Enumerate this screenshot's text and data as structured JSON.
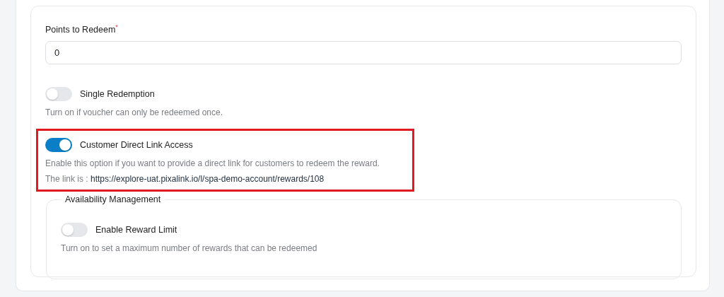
{
  "points_field": {
    "label": "Points to Redeem",
    "required_mark": "*",
    "value": "0"
  },
  "toggles": [
    {
      "label": "Single Redemption",
      "on": false,
      "highlighted": false,
      "description": "Turn on if voucher can only be redeemed once."
    },
    {
      "label": "Customer Direct Link Access",
      "on": true,
      "highlighted": true,
      "description": "Enable this option if you want to provide a direct link for customers to redeem the reward.",
      "link_prefix": "The link is : ",
      "link": "https://explore-uat.pixalink.io/l/spa-demo-account/rewards/108"
    }
  ],
  "availability": {
    "legend": "Availability Management",
    "toggles": [
      {
        "label": "Enable Reward Limit",
        "on": false,
        "description": "Turn on to set a maximum number of rewards that can be redeemed"
      }
    ]
  }
}
